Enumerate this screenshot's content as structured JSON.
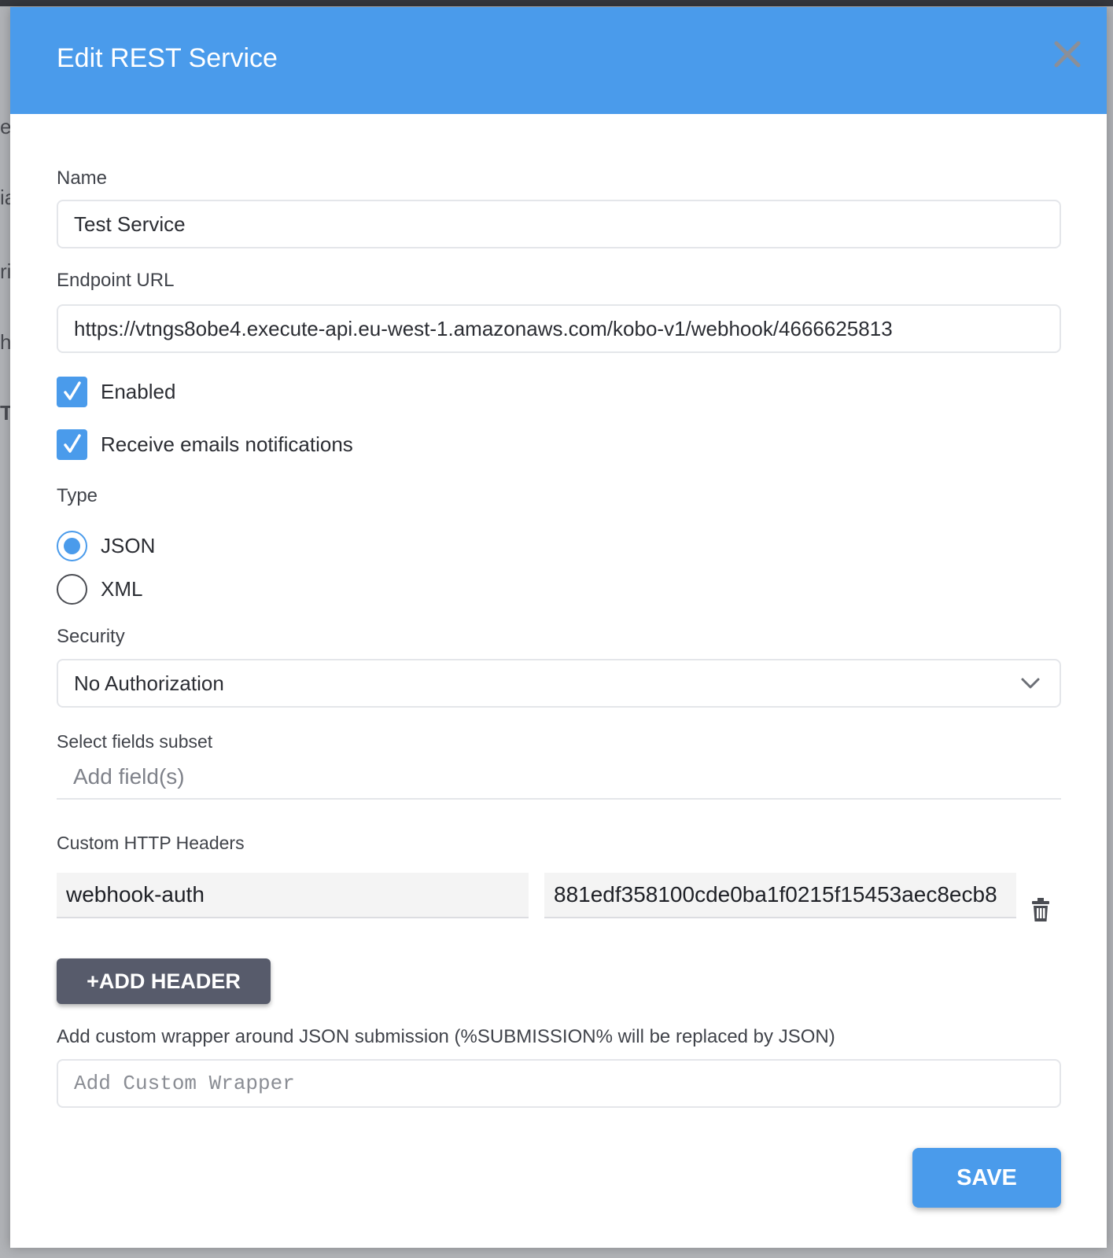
{
  "modal": {
    "title": "Edit REST Service"
  },
  "form": {
    "name_label": "Name",
    "name_value": "Test Service",
    "endpoint_label": "Endpoint URL",
    "endpoint_value": "https://vtngs8obe4.execute-api.eu-west-1.amazonaws.com/kobo-v1/webhook/4666625813",
    "enabled_label": "Enabled",
    "enabled_checked": true,
    "emails_label": "Receive emails notifications",
    "emails_checked": true,
    "type_label": "Type",
    "type_options": [
      "JSON",
      "XML"
    ],
    "type_selected": "JSON",
    "security_label": "Security",
    "security_value": "No Authorization",
    "fields_label": "Select fields subset",
    "fields_placeholder": "Add field(s)",
    "headers_label": "Custom HTTP Headers",
    "headers": [
      {
        "name": "webhook-auth",
        "value": "881edf358100cde0ba1f0215f15453aec8ecb8"
      }
    ],
    "add_header_label": "+ADD HEADER",
    "wrapper_label": "Add custom wrapper around JSON submission (%SUBMISSION% will be replaced by JSON)",
    "wrapper_placeholder": "Add Custom Wrapper",
    "save_label": "SAVE"
  },
  "background": {
    "partial_letters": [
      "e",
      "ia",
      "ri",
      "h",
      "T"
    ]
  },
  "colors": {
    "accent": "#4a9beb",
    "add_header_button": "#575b6b",
    "backdrop": "#a9abaf"
  },
  "icons": {
    "close": "close-icon",
    "check": "checkmark-icon",
    "dropdown": "chevron-down-icon",
    "delete": "trash-icon"
  }
}
